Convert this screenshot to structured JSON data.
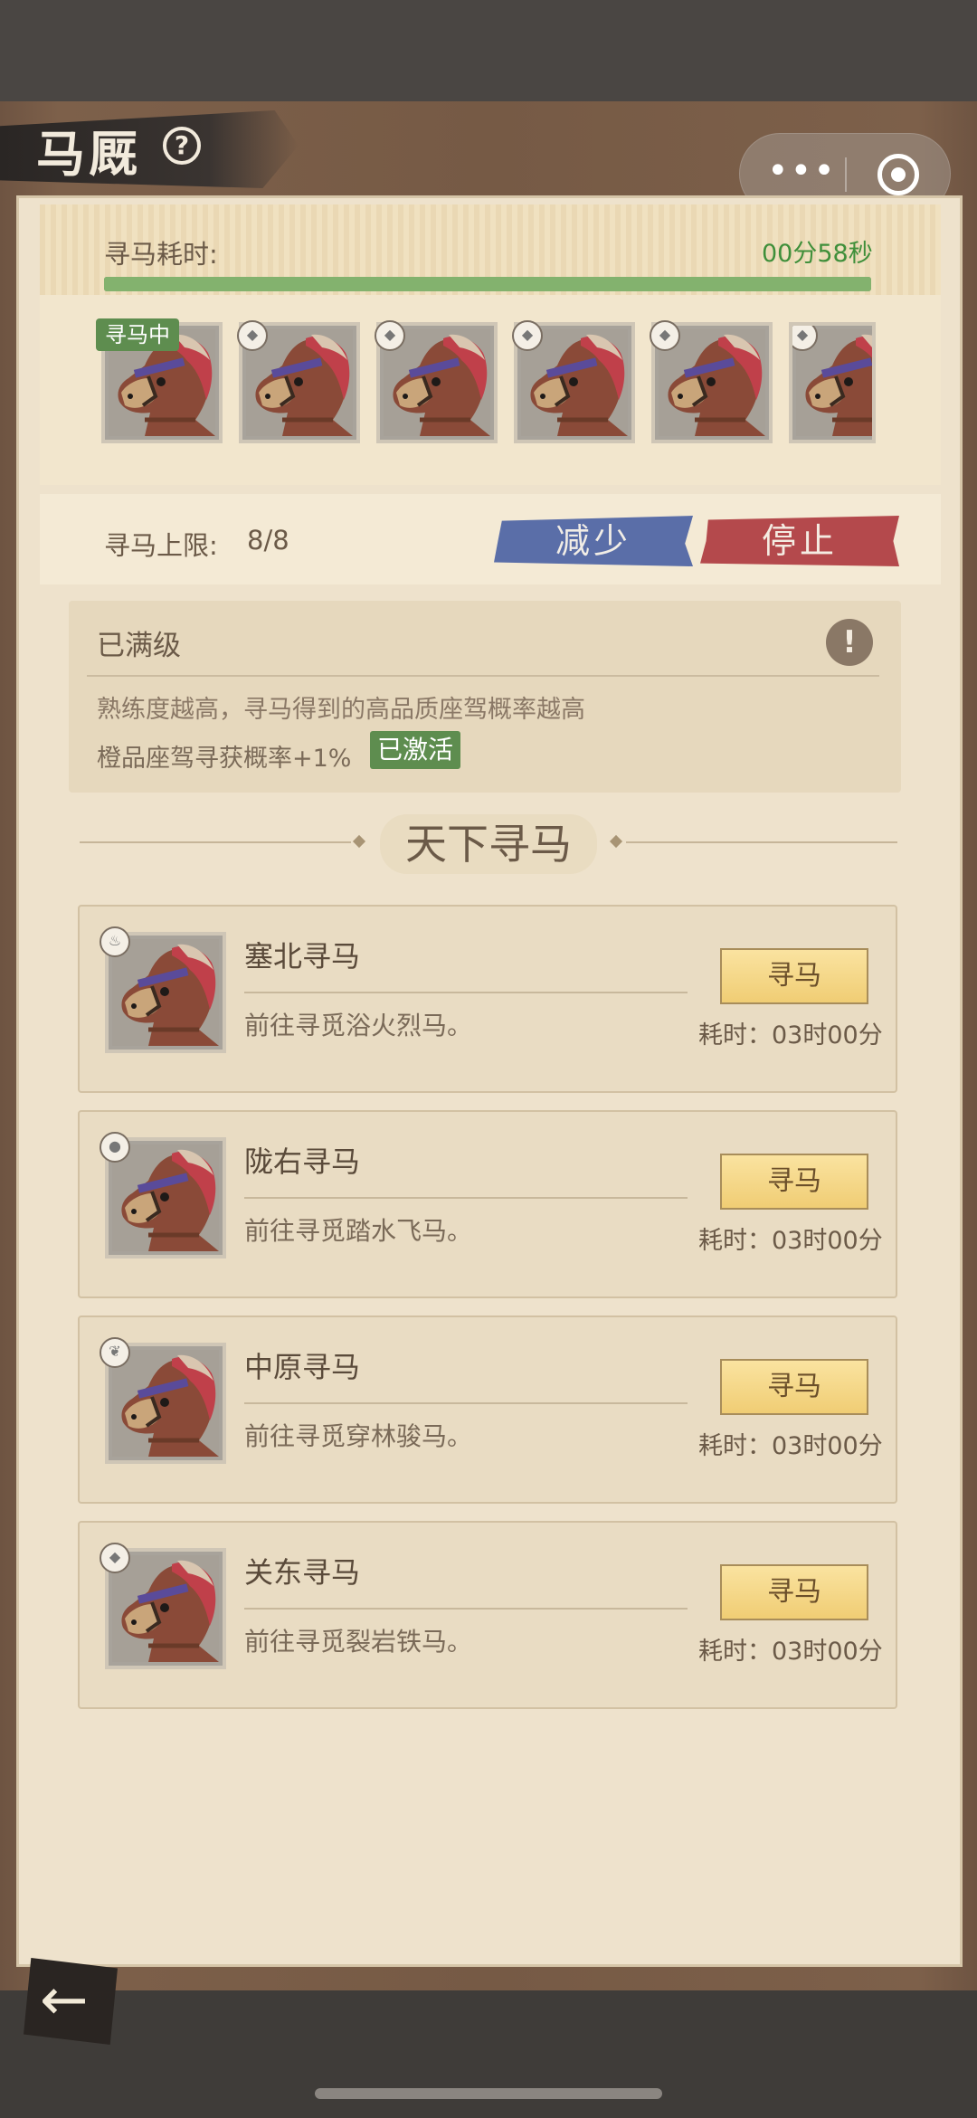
{
  "header": {
    "title": "马厩",
    "help_icon": "?"
  },
  "capsule": {
    "more_icon": "•••"
  },
  "search": {
    "time_label": "寻马耗时:",
    "time_remaining": "00分58秒",
    "progress": 1.0,
    "searching_tag": "寻马中",
    "slots": [
      {
        "element": "horse",
        "status": "searching"
      },
      {
        "element": "horse",
        "status": "queued"
      },
      {
        "element": "horse",
        "status": "queued"
      },
      {
        "element": "horse",
        "status": "queued"
      },
      {
        "element": "horse",
        "status": "queued"
      },
      {
        "element": "horse",
        "status": "queued"
      }
    ],
    "limit_label": "寻马上限:",
    "limit_value": "8/8",
    "reduce_button": "减少",
    "stop_button": "停止"
  },
  "proficiency": {
    "level": "已满级",
    "info_icon": "!",
    "description": "熟练度越高，寻马得到的高品质座驾概率越高",
    "bonus": "橙品座驾寻获概率+1%",
    "activated": "已激活"
  },
  "section_title": "天下寻马",
  "routes": [
    {
      "name": "塞北寻马",
      "desc": "前往寻觅浴火烈马。",
      "button": "寻马",
      "cost": "耗时：03时00分",
      "badge_icon": "fire-icon"
    },
    {
      "name": "陇右寻马",
      "desc": "前往寻觅踏水飞马。",
      "button": "寻马",
      "cost": "耗时：03时00分",
      "badge_icon": "water-icon"
    },
    {
      "name": "中原寻马",
      "desc": "前往寻觅穿林骏马。",
      "button": "寻马",
      "cost": "耗时：03时00分",
      "badge_icon": "leaf-icon"
    },
    {
      "name": "关东寻马",
      "desc": "前往寻觅裂岩铁马。",
      "button": "寻马",
      "cost": "耗时：03时00分",
      "badge_icon": "rock-icon"
    }
  ],
  "back_icon": "←",
  "colors": {
    "accent_green": "#5e8d4f",
    "reduce_blue": "#5a6ea8",
    "stop_red": "#b4494c",
    "gold_button": "#f0cd74"
  }
}
